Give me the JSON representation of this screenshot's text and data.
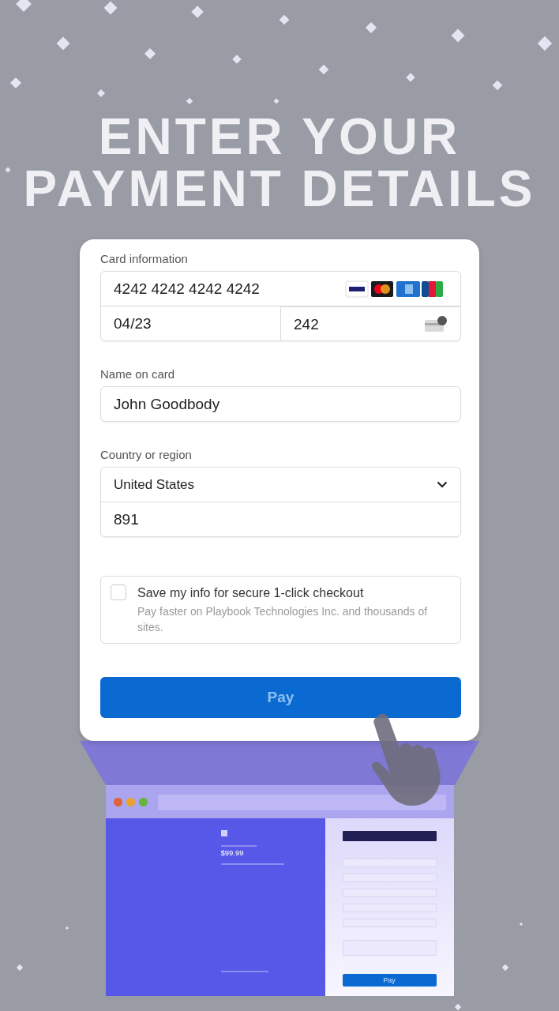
{
  "headline": {
    "lines": [
      "ENTER YOUR",
      "PAYMENT DETAILS"
    ]
  },
  "payment_form": {
    "card_information": {
      "label": "Card information",
      "number": "4242 4242 4242 4242",
      "expiry": "04/23",
      "cvc": "242"
    },
    "name_on_card": {
      "label": "Name on card",
      "value": "John Goodbody"
    },
    "country": {
      "label": "Country or region",
      "value": "United States",
      "postal_code": "891"
    },
    "save_info": {
      "checked": false,
      "title": "Save my info for secure 1-click checkout",
      "description": "Pay faster on Playbook Technologies Inc. and thousands of sites."
    },
    "pay_button": {
      "label": "Pay",
      "disabled": true
    }
  },
  "mini_browser": {
    "price": "$99.99",
    "pay_button": "Pay"
  }
}
